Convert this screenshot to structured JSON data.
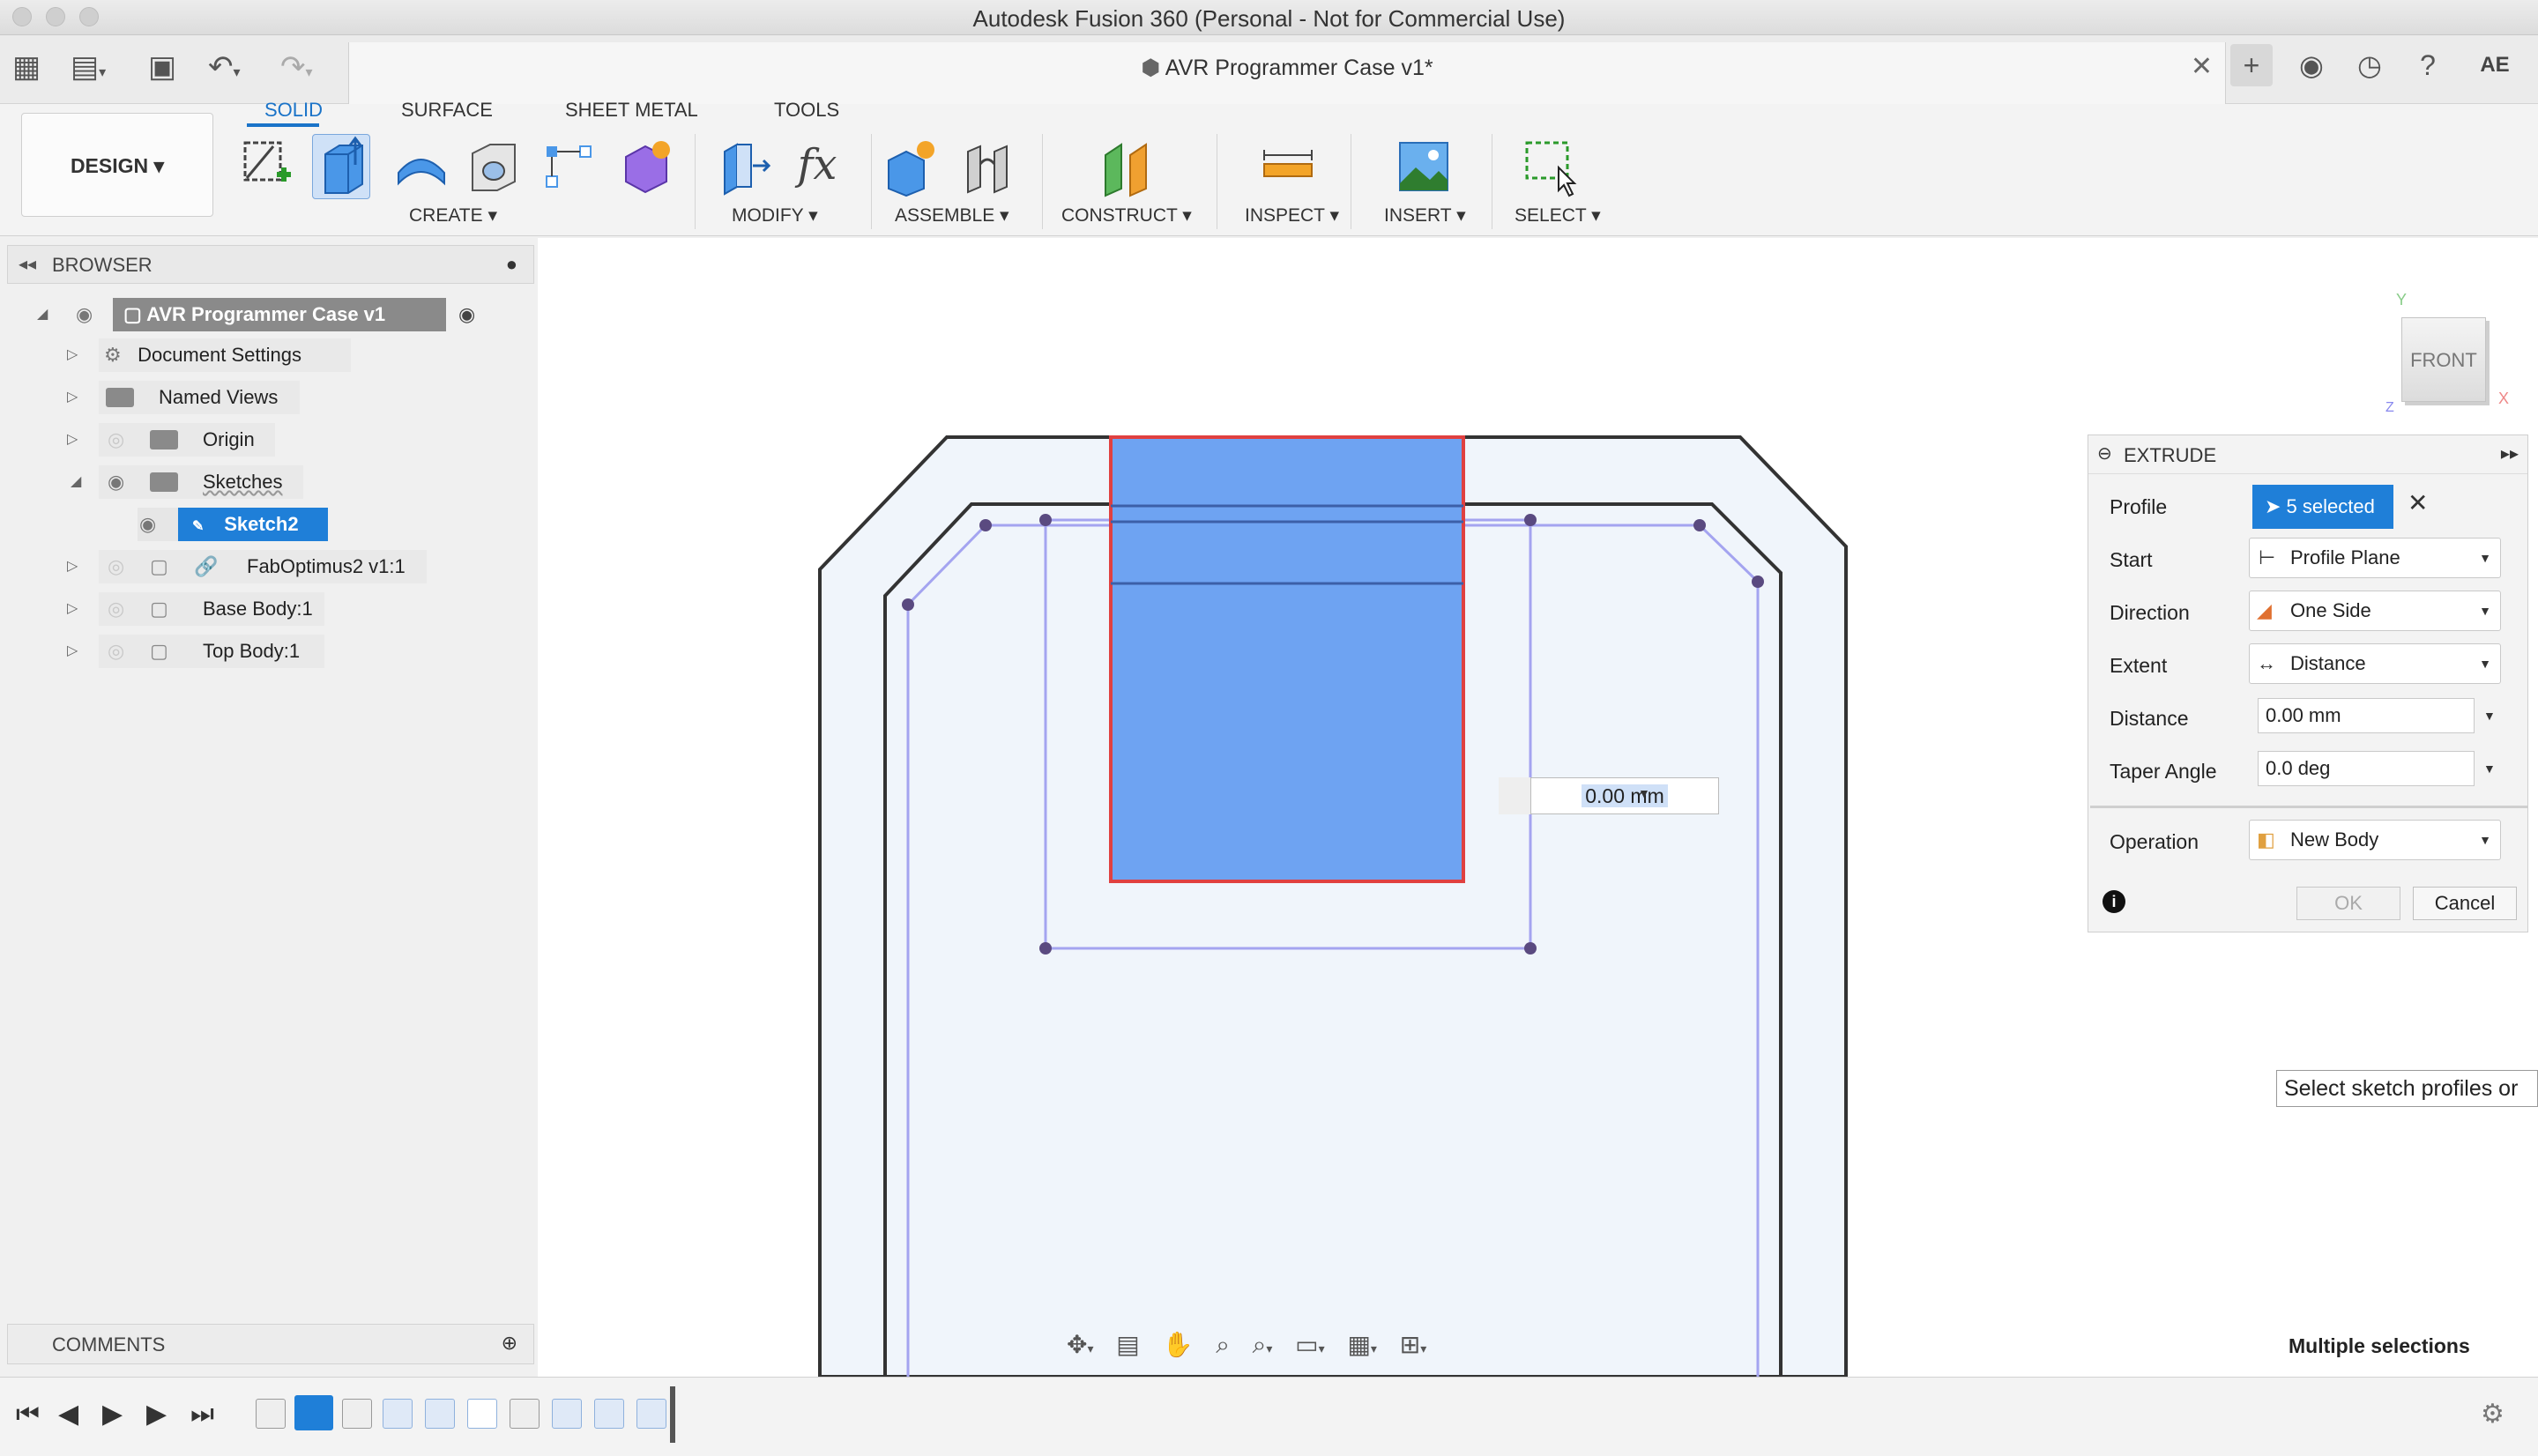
{
  "window": {
    "title": "Autodesk Fusion 360 (Personal - Not for Commercial Use)"
  },
  "document": {
    "tab_title": "AVR Programmer Case v1*",
    "close_glyph": "✕"
  },
  "user": {
    "initials": "AE"
  },
  "workspace": {
    "label": "DESIGN ▾"
  },
  "tabs": [
    "SOLID",
    "SURFACE",
    "SHEET METAL",
    "TOOLS"
  ],
  "tool_groups": {
    "create": "CREATE ▾",
    "modify": "MODIFY ▾",
    "assemble": "ASSEMBLE ▾",
    "construct": "CONSTRUCT ▾",
    "inspect": "INSPECT ▾",
    "insert": "INSERT ▾",
    "select": "SELECT ▾"
  },
  "browser": {
    "title": "BROWSER",
    "root": "AVR Programmer Case v1",
    "items": [
      {
        "label": "Document Settings"
      },
      {
        "label": "Named Views"
      },
      {
        "label": "Origin"
      },
      {
        "label": "Sketches"
      },
      {
        "label": "Sketch2"
      },
      {
        "label": "FabOptimus2 v1:1"
      },
      {
        "label": "Base Body:1"
      },
      {
        "label": "Top Body:1"
      }
    ]
  },
  "viewcube": {
    "face": "FRONT",
    "axis_y": "Y",
    "axis_x": "X",
    "axis_z": "Z"
  },
  "viewport": {
    "dimension_input": "0.00 mm",
    "tooltip": "Select sketch profiles or",
    "status": "Multiple selections"
  },
  "extrude": {
    "title": "EXTRUDE",
    "profile_label": "Profile",
    "profile_value": "5 selected",
    "start_label": "Start",
    "start_value": "Profile Plane",
    "direction_label": "Direction",
    "direction_value": "One Side",
    "extent_label": "Extent",
    "extent_value": "Distance",
    "distance_label": "Distance",
    "distance_value": "0.00 mm",
    "taper_label": "Taper Angle",
    "taper_value": "0.0 deg",
    "operation_label": "Operation",
    "operation_value": "New Body",
    "ok_label": "OK",
    "cancel_label": "Cancel"
  },
  "comments": {
    "title": "COMMENTS"
  },
  "colors": {
    "accent": "#1a73c8",
    "profile_fill": "#6ea3f2",
    "selection_edge": "#e04040",
    "sketch_line": "#a4a4f0"
  }
}
